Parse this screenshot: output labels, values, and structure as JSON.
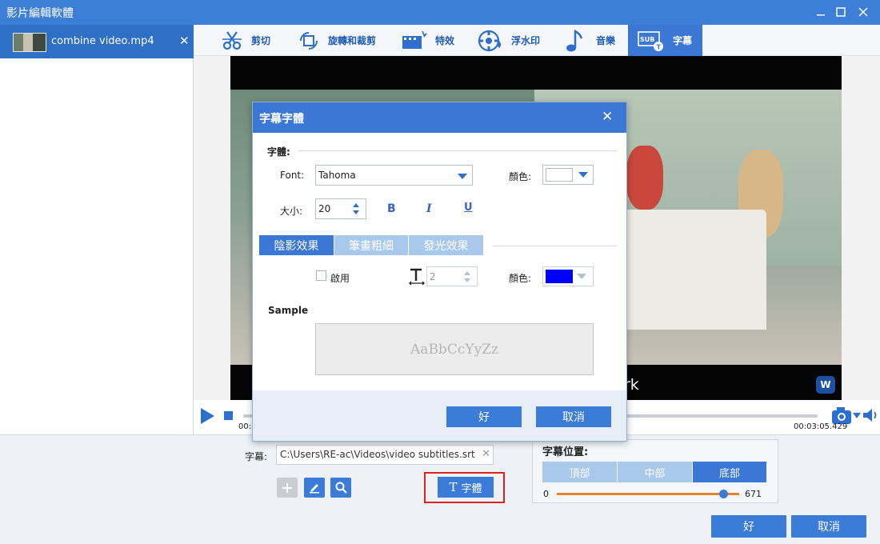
{
  "window": {
    "title": "影片編輯軟體"
  },
  "file_list": [
    {
      "name": "combine video.mp4",
      "close": "✕"
    }
  ],
  "toolbar": {
    "items": [
      {
        "label": "剪切",
        "icon": "scissors-icon"
      },
      {
        "label": "旋轉和裁剪",
        "icon": "rotate-crop-icon"
      },
      {
        "label": "特效",
        "icon": "effects-icon"
      },
      {
        "label": "浮水印",
        "icon": "watermark-icon"
      },
      {
        "label": "音樂",
        "icon": "music-note-icon"
      },
      {
        "label": "字幕",
        "icon": "subtitle-icon"
      }
    ],
    "active": "字幕"
  },
  "video": {
    "subtitle_fragment": "rk",
    "logo_text": "W"
  },
  "player": {
    "time_current": "00:",
    "time_total": "00:03:05.429"
  },
  "subtitle_file": {
    "label": "字幕:",
    "path": "C:\\Users\\RE-ac\\Videos\\video subtitles.srt",
    "clear": "✕"
  },
  "font_button": {
    "icon": "T",
    "label": "字體"
  },
  "position": {
    "title": "字幕位置:",
    "options": [
      "頂部",
      "中部",
      "底部"
    ],
    "selected": "底部",
    "slider_min": "0",
    "slider_value": "671"
  },
  "main_buttons": {
    "ok": "好",
    "cancel": "取消"
  },
  "dialog": {
    "title": "字幕字體",
    "close": "✕",
    "font_section": "字體:",
    "font_label": "Font:",
    "font_value": "Tahoma",
    "color_label": "顏色:",
    "font_color": "#ffffff",
    "size_label": "大小:",
    "size_value": "20",
    "bold": "B",
    "italic": "I",
    "underline": "U",
    "tabs": [
      "陰影效果",
      "筆畫粗細",
      "發光效果"
    ],
    "active_tab": "陰影效果",
    "enable_label": "啟用",
    "shadow_size_value": "2",
    "shadow_color_label": "顏色:",
    "shadow_color": "#0000ff",
    "sample_label": "Sample",
    "sample_text": "AaBbCcYyZz",
    "ok": "好",
    "cancel": "取消"
  }
}
